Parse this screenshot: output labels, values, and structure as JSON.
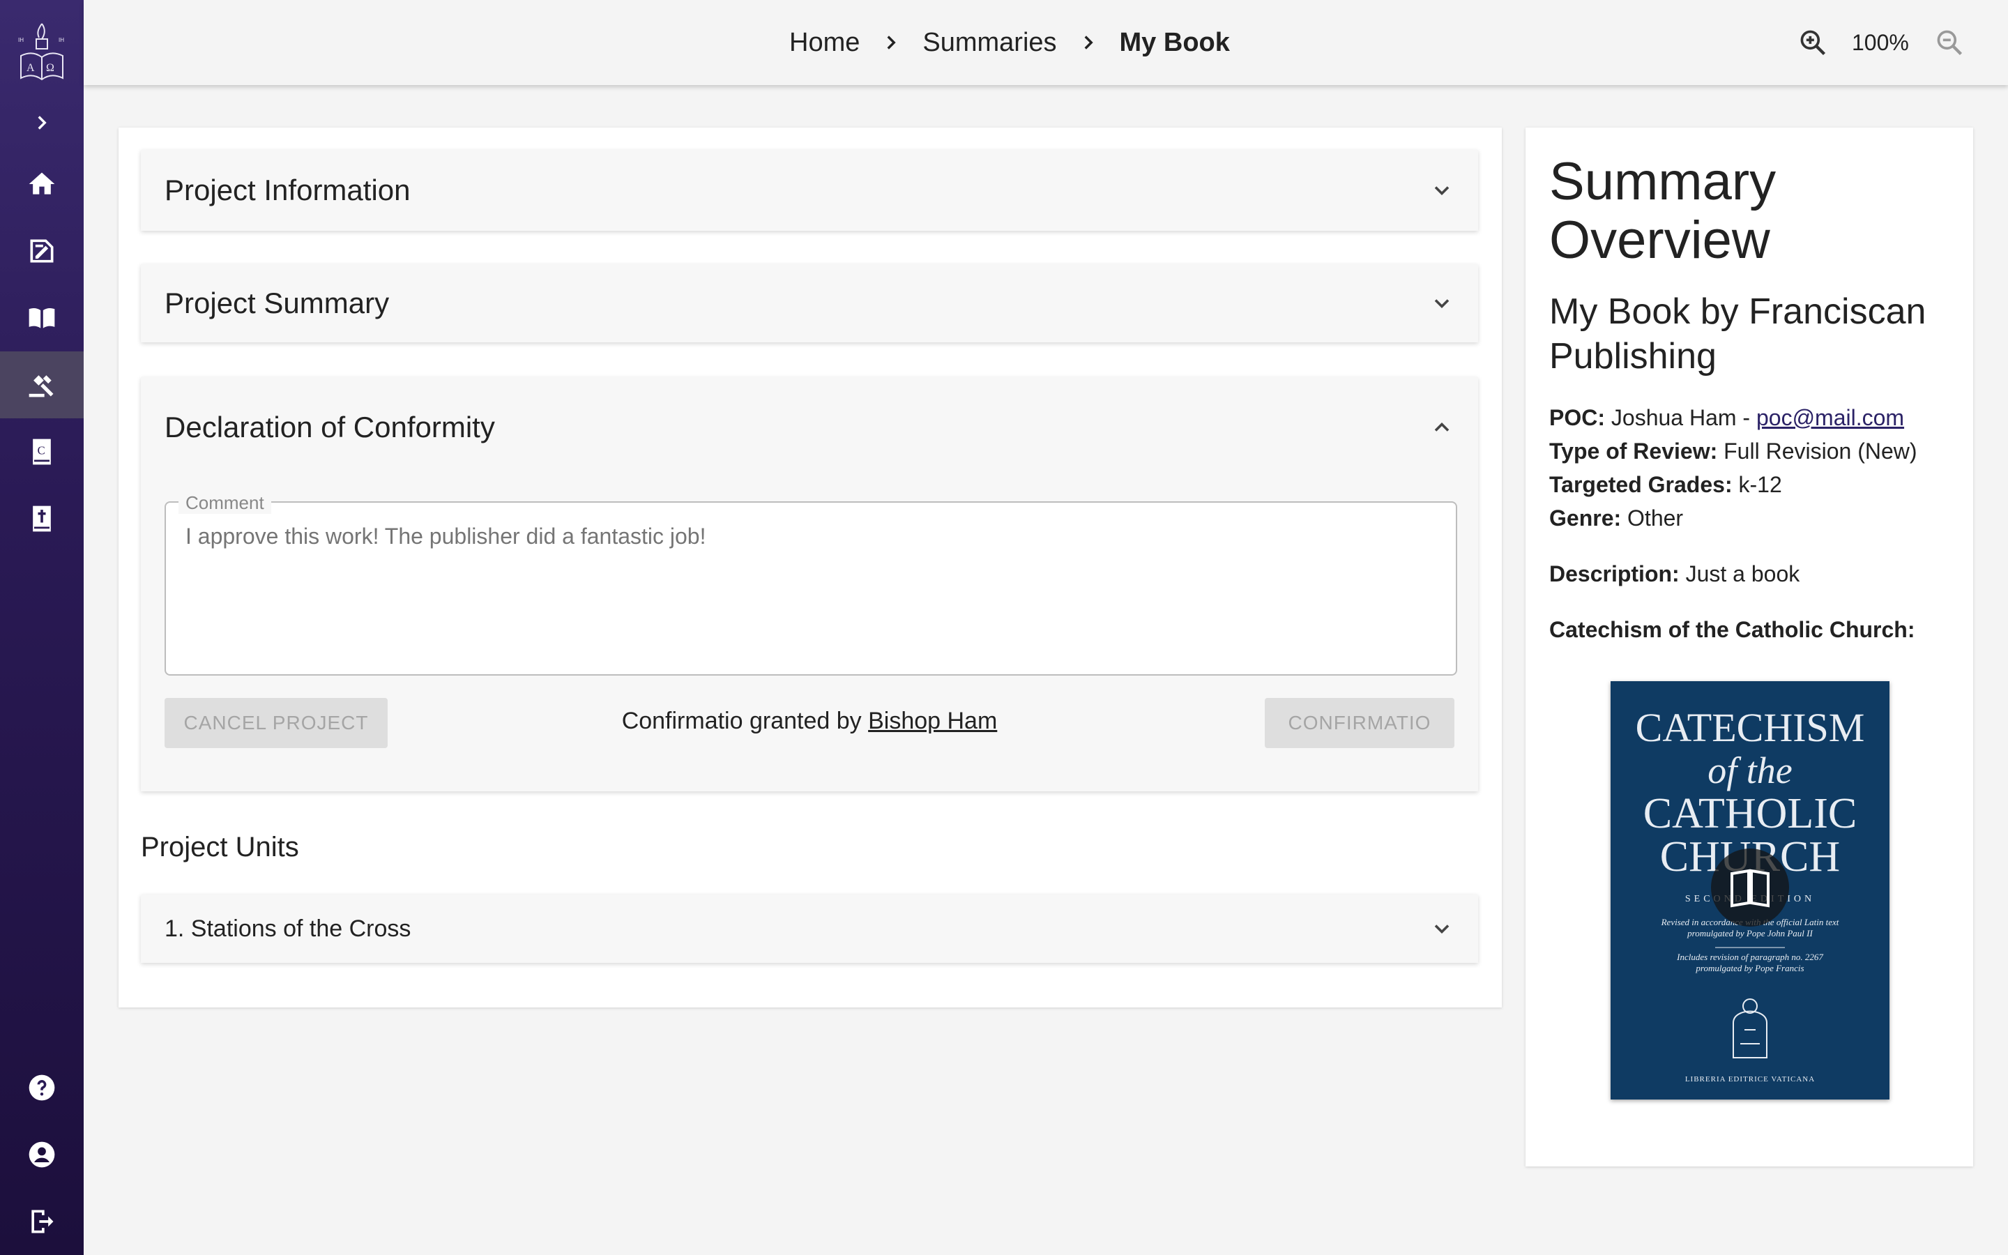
{
  "breadcrumb": {
    "items": [
      "Home",
      "Summaries"
    ],
    "current": "My Book"
  },
  "zoom": {
    "level": "100%"
  },
  "sidebar": {
    "items": [
      {
        "name": "expand",
        "icon": "chevron-right-icon"
      },
      {
        "name": "home",
        "icon": "home-icon"
      },
      {
        "name": "publish",
        "icon": "edit-book-icon"
      },
      {
        "name": "library",
        "icon": "open-book-icon"
      },
      {
        "name": "review",
        "icon": "gavel-icon",
        "active": true
      },
      {
        "name": "catechism",
        "icon": "catechism-book-icon"
      },
      {
        "name": "bible",
        "icon": "bible-icon"
      },
      {
        "name": "help",
        "icon": "help-icon"
      },
      {
        "name": "account",
        "icon": "account-icon"
      },
      {
        "name": "logout",
        "icon": "logout-icon"
      }
    ]
  },
  "main": {
    "sections": {
      "project_information": "Project Information",
      "project_summary": "Project Summary",
      "declaration": "Declaration of Conformity"
    },
    "comment": {
      "label": "Comment",
      "placeholder": "I approve this work! The publisher did a fantastic job!"
    },
    "cancel_label": "CANCEL PROJECT",
    "confirm_label": "CONFIRMATIO",
    "granted_prefix": "Confirmatio granted by",
    "granted_by": "Bishop Ham",
    "units_title": "Project Units",
    "units": [
      "1. Stations of the Cross"
    ]
  },
  "overview": {
    "title": "Summary Overview",
    "book": "My Book by Franciscan Publishing",
    "poc_label": "POC:",
    "poc_name": "Joshua Ham -",
    "poc_email": "poc@mail.com",
    "review_label": "Type of Review:",
    "review_value": "Full Revision (New)",
    "grades_label": "Targeted Grades:",
    "grades_value": "k-12",
    "genre_label": "Genre:",
    "genre_value": "Other",
    "description_label": "Description:",
    "description_value": "Just a book",
    "catechism_label": "Catechism of the Catholic Church:",
    "cover": {
      "line1": "CATECHISM",
      "line2": "of the",
      "line3": "CATHOLIC",
      "line4": "CHURCH",
      "edition": "SECOND EDITION",
      "sub1": "Revised in accordance with the official Latin text",
      "sub2": "promulgated by Pope John Paul II",
      "sub3": "Includes revision of paragraph no. 2267",
      "sub4": "promulgated by Pope Francis",
      "publisher": "LIBRERIA EDITRICE VATICANA"
    }
  },
  "colors": {
    "sidebar_top": "#3a2a6e",
    "sidebar_bottom": "#1c0f3c",
    "cover": "#0f3b63"
  }
}
